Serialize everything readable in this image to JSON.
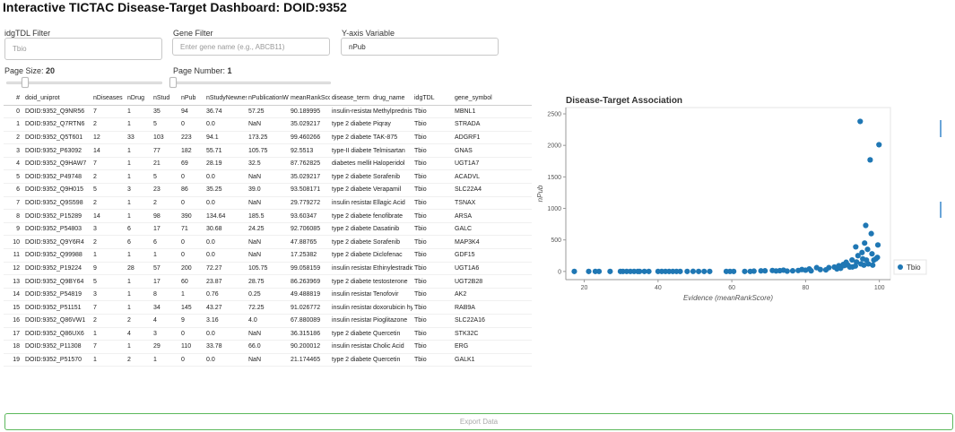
{
  "header": {
    "title": "Interactive TICTAC Disease-Target Dashboard: DOID:9352"
  },
  "filters": {
    "tdl_label": "idgTDL Filter",
    "tdl_placeholder": "Tbio",
    "gene_label": "Gene Filter",
    "gene_placeholder": "Enter gene name (e.g., ABCB11)",
    "yaxis_label": "Y-axis Variable",
    "yaxis_value": "nPub",
    "page_size_label": "Page Size:",
    "page_size_value": "20",
    "page_size_slider_fraction": 0.1,
    "page_number_label": "Page Number:",
    "page_number_value": "1",
    "page_number_slider_fraction": 0.0
  },
  "table": {
    "columns": [
      "#",
      "doid_uniprot",
      "nDiseases",
      "nDrug",
      "nStud",
      "nPub",
      "nStudyNewness",
      "nPublicationWe",
      "meanRankScor",
      "disease_term",
      "drug_name",
      "idgTDL",
      "gene_symbol"
    ],
    "rows": [
      [
        "0",
        "DOID:9352_Q9NR56",
        "7",
        "1",
        "35",
        "94",
        "36.74",
        "57.25",
        "90.189995",
        "insulin-resistan",
        "Methylpredniso",
        "Tbio",
        "MBNL1"
      ],
      [
        "1",
        "DOID:9352_Q7RTN6",
        "2",
        "1",
        "5",
        "0",
        "0.0",
        "NaN",
        "35.029217",
        "type 2 diabetes",
        "Piqray",
        "Tbio",
        "STRADA"
      ],
      [
        "2",
        "DOID:9352_Q5T601",
        "12",
        "33",
        "103",
        "223",
        "94.1",
        "173.25",
        "99.460266",
        "type 2 diabetes",
        "TAK-875",
        "Tbio",
        "ADGRF1"
      ],
      [
        "3",
        "DOID:9352_P63092",
        "14",
        "1",
        "77",
        "182",
        "55.71",
        "105.75",
        "92.5513",
        "type-II diabetes",
        "Telmisartan",
        "Tbio",
        "GNAS"
      ],
      [
        "4",
        "DOID:9352_Q9HAW7",
        "7",
        "1",
        "21",
        "69",
        "28.19",
        "32.5",
        "87.762825",
        "diabetes mellitu",
        "Haloperidol",
        "Tbio",
        "UGT1A7"
      ],
      [
        "5",
        "DOID:9352_P49748",
        "2",
        "1",
        "5",
        "0",
        "0.0",
        "NaN",
        "35.029217",
        "type 2 diabetes",
        "Sorafenib",
        "Tbio",
        "ACADVL"
      ],
      [
        "6",
        "DOID:9352_Q9H015",
        "5",
        "3",
        "23",
        "86",
        "35.25",
        "39.0",
        "93.508171",
        "type 2 diabetes",
        "Verapamil",
        "Tbio",
        "SLC22A4"
      ],
      [
        "7",
        "DOID:9352_Q9S598",
        "2",
        "1",
        "2",
        "0",
        "0.0",
        "NaN",
        "29.779272",
        "insulin resistan",
        "Ellagic Acid",
        "Tbio",
        "TSNAX"
      ],
      [
        "8",
        "DOID:9352_P15289",
        "14",
        "1",
        "98",
        "390",
        "134.64",
        "185.5",
        "93.60347",
        "type 2 diabetes",
        "fenofibrate",
        "Tbio",
        "ARSA"
      ],
      [
        "9",
        "DOID:9352_P54803",
        "3",
        "6",
        "17",
        "71",
        "30.68",
        "24.25",
        "92.706085",
        "type 2 diabetes",
        "Dasatinib",
        "Tbio",
        "GALC"
      ],
      [
        "10",
        "DOID:9352_Q9Y6R4",
        "2",
        "6",
        "6",
        "0",
        "0.0",
        "NaN",
        "47.88765",
        "type 2 diabetes",
        "Sorafenib",
        "Tbio",
        "MAP3K4"
      ],
      [
        "11",
        "DOID:9352_Q99988",
        "1",
        "1",
        "1",
        "0",
        "0.0",
        "NaN",
        "17.25382",
        "type 2 diabetes",
        "Diclofenac",
        "Tbio",
        "GDF15"
      ],
      [
        "12",
        "DOID:9352_P19224",
        "9",
        "28",
        "57",
        "200",
        "72.27",
        "105.75",
        "99.058159",
        "insulin resistan",
        "Ethinylestradio",
        "Tbio",
        "UGT1A6"
      ],
      [
        "13",
        "DOID:9352_Q9BY64",
        "5",
        "1",
        "17",
        "60",
        "23.87",
        "28.75",
        "86.263969",
        "type 2 diabetes",
        "testosterone",
        "Tbio",
        "UGT2B28"
      ],
      [
        "14",
        "DOID:9352_P54819",
        "3",
        "1",
        "8",
        "1",
        "0.76",
        "0.25",
        "49.488819",
        "insulin resistan",
        "Tenofovir",
        "Tbio",
        "AK2"
      ],
      [
        "15",
        "DOID:9352_P51151",
        "7",
        "1",
        "34",
        "145",
        "43.27",
        "72.25",
        "91.026772",
        "insulin resistan",
        "doxorubicin hyd",
        "Tbio",
        "RAB9A"
      ],
      [
        "16",
        "DOID:9352_Q86VW1",
        "2",
        "2",
        "4",
        "9",
        "3.16",
        "4.0",
        "67.880089",
        "insulin resistan",
        "Pioglitazone",
        "Tbio",
        "SLC22A16"
      ],
      [
        "17",
        "DOID:9352_Q86UX6",
        "1",
        "4",
        "3",
        "0",
        "0.0",
        "NaN",
        "36.315186",
        "type 2 diabetes",
        "Quercetin",
        "Tbio",
        "STK32C"
      ],
      [
        "18",
        "DOID:9352_P11308",
        "7",
        "1",
        "29",
        "110",
        "33.78",
        "66.0",
        "90.200012",
        "insulin resistan",
        "Cholic Acid",
        "Tbio",
        "ERG"
      ],
      [
        "19",
        "DOID:9352_P51570",
        "1",
        "2",
        "1",
        "0",
        "0.0",
        "NaN",
        "21.174465",
        "type 2 diabetes",
        "Quercetin",
        "Tbio",
        "GALK1"
      ]
    ]
  },
  "chart_data": {
    "type": "scatter",
    "title": "Disease-Target Association",
    "xlabel": "Evidence (meanRankScore)",
    "ylabel": "nPub",
    "xlim": [
      15,
      103
    ],
    "ylim": [
      -130,
      2600
    ],
    "xticks": [
      20,
      40,
      60,
      80,
      100
    ],
    "yticks": [
      0,
      500,
      1000,
      1500,
      2000,
      2500
    ],
    "legend_position": "right",
    "series": [
      {
        "name": "Tbio",
        "color": "#1f77b4",
        "points": [
          [
            17.3,
            0
          ],
          [
            21.2,
            0
          ],
          [
            23,
            0
          ],
          [
            24,
            0
          ],
          [
            27,
            0
          ],
          [
            29.8,
            0
          ],
          [
            30.5,
            0
          ],
          [
            31.5,
            0
          ],
          [
            32.5,
            0
          ],
          [
            33.5,
            0
          ],
          [
            34.5,
            0
          ],
          [
            35.0,
            0
          ],
          [
            36.3,
            0
          ],
          [
            37.5,
            0
          ],
          [
            40,
            0
          ],
          [
            41,
            0
          ],
          [
            42,
            0
          ],
          [
            43,
            0
          ],
          [
            44,
            0
          ],
          [
            45,
            0
          ],
          [
            46,
            0
          ],
          [
            47.9,
            0
          ],
          [
            49.5,
            1
          ],
          [
            51,
            0
          ],
          [
            52.5,
            0
          ],
          [
            54,
            0
          ],
          [
            58.5,
            0
          ],
          [
            59.5,
            0
          ],
          [
            60.5,
            0
          ],
          [
            63.5,
            0
          ],
          [
            65,
            0
          ],
          [
            66,
            5
          ],
          [
            67.9,
            9
          ],
          [
            69,
            10
          ],
          [
            71,
            15
          ],
          [
            72,
            8
          ],
          [
            73,
            12
          ],
          [
            74,
            20
          ],
          [
            75,
            5
          ],
          [
            76.5,
            10
          ],
          [
            78,
            15
          ],
          [
            79,
            30
          ],
          [
            80,
            20
          ],
          [
            81,
            40
          ],
          [
            81.5,
            10
          ],
          [
            83,
            60
          ],
          [
            84,
            30
          ],
          [
            85.5,
            25
          ],
          [
            86.3,
            60
          ],
          [
            87.8,
            69
          ],
          [
            88.5,
            40
          ],
          [
            89,
            90
          ],
          [
            89.5,
            50
          ],
          [
            90.2,
            110
          ],
          [
            90.5,
            94
          ],
          [
            91,
            145
          ],
          [
            91.5,
            100
          ],
          [
            92,
            70
          ],
          [
            92.6,
            182
          ],
          [
            92.7,
            71
          ],
          [
            93.5,
            86
          ],
          [
            93.6,
            390
          ],
          [
            93.8,
            150
          ],
          [
            94.2,
            250
          ],
          [
            94.8,
            2380
          ],
          [
            95,
            120
          ],
          [
            95.3,
            300
          ],
          [
            95.5,
            200
          ],
          [
            95.8,
            100
          ],
          [
            96,
            450
          ],
          [
            96.3,
            730
          ],
          [
            96.5,
            180
          ],
          [
            96.8,
            350
          ],
          [
            97,
            120
          ],
          [
            97.5,
            1770
          ],
          [
            97.8,
            600
          ],
          [
            98,
            280
          ],
          [
            98.2,
            100
          ],
          [
            98.5,
            180
          ],
          [
            99.06,
            200
          ],
          [
            99.46,
            223
          ],
          [
            99.6,
            420
          ],
          [
            99.9,
            2010
          ]
        ]
      }
    ]
  },
  "export": {
    "label": "Export Data"
  }
}
